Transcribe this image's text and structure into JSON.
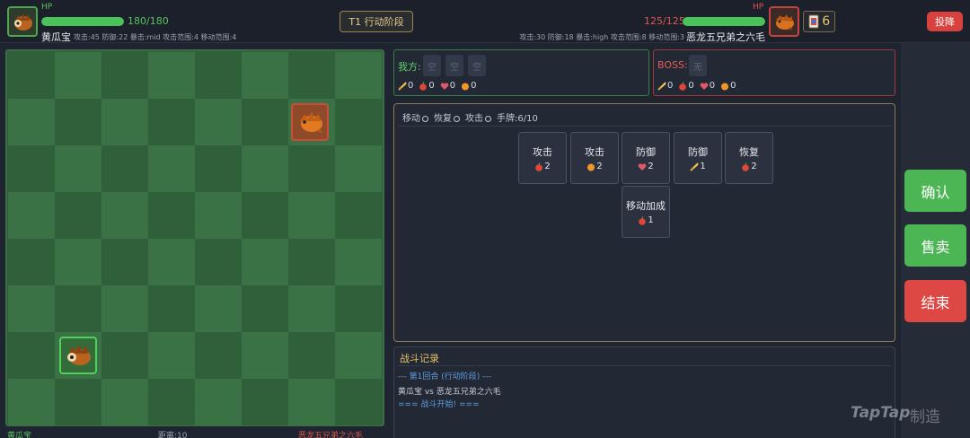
{
  "player": {
    "hp_label": "HP",
    "hp_text": "180/180",
    "hp_fraction": 1.0,
    "name": "黄瓜宝",
    "stats": "攻击:45 防御:22 暴击:mid 攻击范围:4 移动范围:4",
    "icon": "hedgehog-green-icon"
  },
  "boss": {
    "hp_label": "HP",
    "hp_text": "125/125",
    "hp_fraction": 1.0,
    "name": "恶龙五兄弟之六毛",
    "stats": "攻击:30 防御:18 暴击:high 攻击范围:8 移动范围:3",
    "icon": "orange-dragon-icon"
  },
  "phase_label": "T1 行动阶段",
  "deck": {
    "icon": "card-deck-icon",
    "count": "6"
  },
  "surrender_label": "投降",
  "board_footer": {
    "left": "黄瓜宝",
    "mid": "距离:10",
    "right": "恶龙五兄弟之六毛"
  },
  "my_panel": {
    "title": "我方:",
    "slots": [
      "空",
      "空",
      "空"
    ],
    "resources": [
      {
        "icon": "sword-icon",
        "value": "0"
      },
      {
        "icon": "apple-icon",
        "value": "0"
      },
      {
        "icon": "heart-icon",
        "value": "0"
      },
      {
        "icon": "orange-icon",
        "value": "0"
      }
    ]
  },
  "boss_panel": {
    "title": "BOSS:",
    "slots": [
      "无"
    ],
    "resources": [
      {
        "icon": "sword-icon",
        "value": "0"
      },
      {
        "icon": "apple-icon",
        "value": "0"
      },
      {
        "icon": "heart-icon",
        "value": "0"
      },
      {
        "icon": "orange-icon",
        "value": "0"
      }
    ]
  },
  "hand": {
    "move_label": "移动",
    "recover_label": "恢复",
    "attack_label": "攻击",
    "count_text": "手牌:6/10",
    "cards": [
      {
        "name": "攻击",
        "cost_icon": "apple-icon",
        "cost": "2"
      },
      {
        "name": "攻击",
        "cost_icon": "orange-icon",
        "cost": "2"
      },
      {
        "name": "防御",
        "cost_icon": "heart-icon",
        "cost": "2"
      },
      {
        "name": "防御",
        "cost_icon": "sword-icon",
        "cost": "1"
      },
      {
        "name": "恢复",
        "cost_icon": "apple-icon",
        "cost": "2"
      },
      {
        "name": "移动加成",
        "cost_icon": "apple-icon",
        "cost": "1"
      }
    ]
  },
  "log": {
    "title": "战斗记录",
    "lines": [
      "--- 第1回合 (行动阶段) ---",
      "黄瓜宝 vs 恶龙五兄弟之六毛",
      "=== 战斗开始! ==="
    ]
  },
  "actions": {
    "confirm": "确认",
    "sell": "售卖",
    "end": "结束"
  },
  "watermark": {
    "brand": "TapTap",
    "suffix": "制造"
  },
  "colors": {
    "green": "#4cb654",
    "red": "#dd4845",
    "gold": "#e3c98a",
    "board_light": "#3a7145",
    "board_dark": "#2f603a"
  }
}
